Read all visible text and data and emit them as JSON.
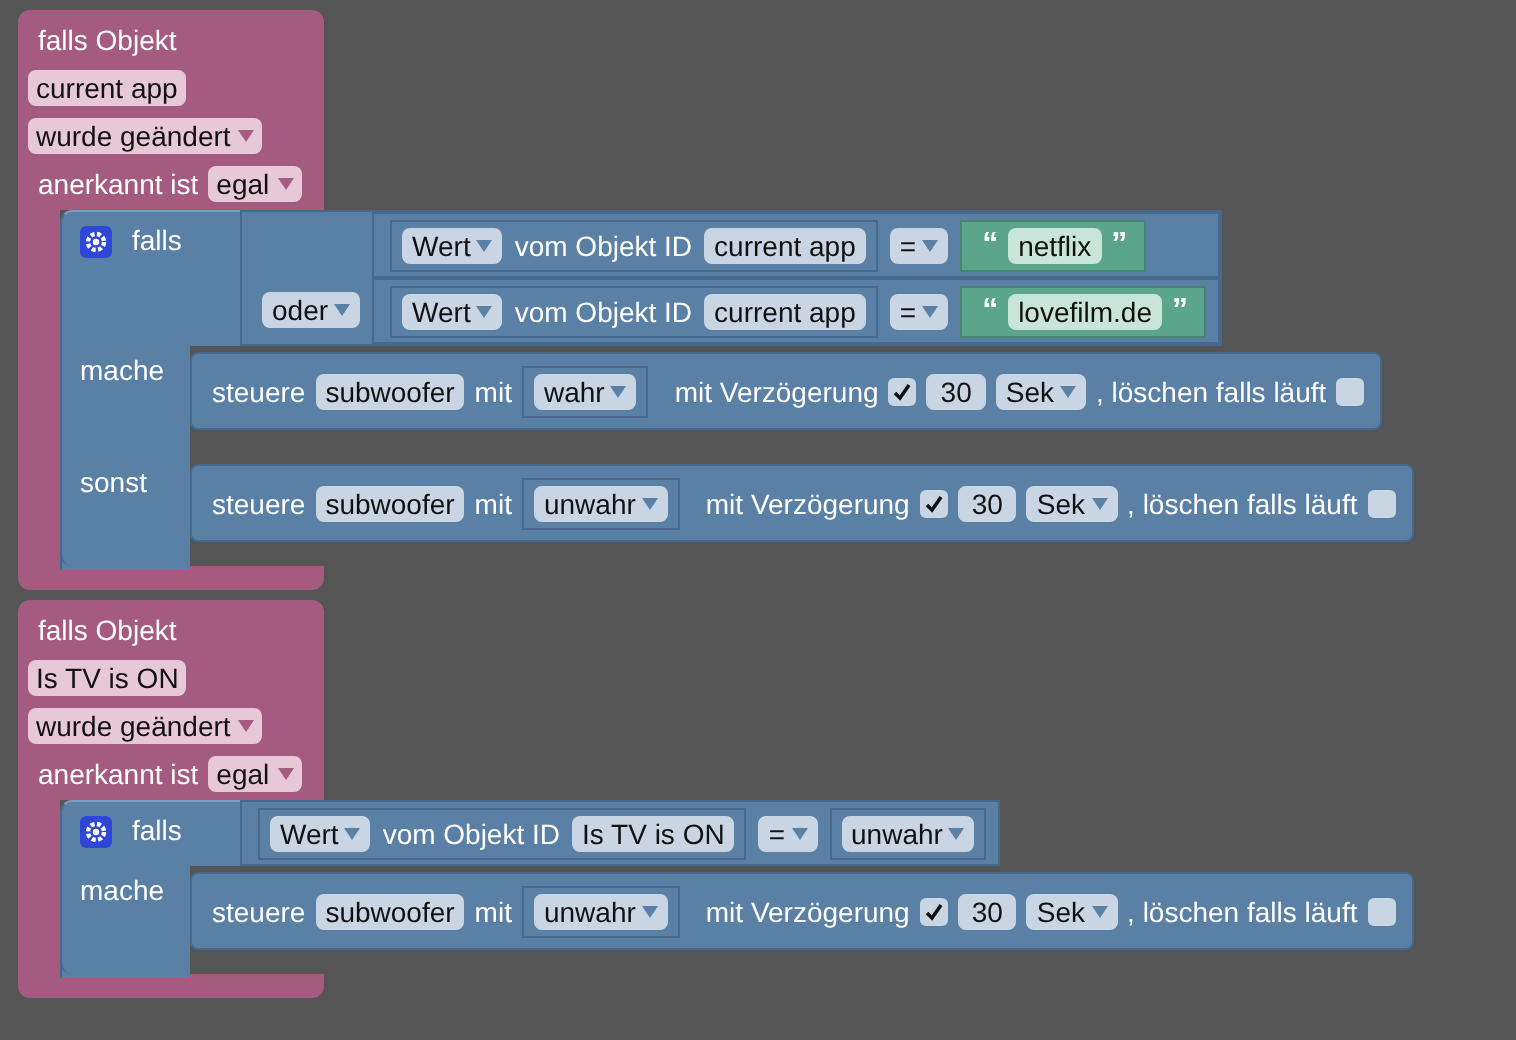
{
  "events": [
    {
      "header": "falls Objekt",
      "object": "current app",
      "trigger": "wurde geändert",
      "ack_label": "anerkannt ist",
      "ack": "egal",
      "if_block": {
        "label": "falls",
        "logic_op": "oder",
        "conditions": [
          {
            "value_field": "Wert",
            "id_label": "vom Objekt ID",
            "object": "current app",
            "operator": "=",
            "operand": {
              "kind": "string",
              "open_quote": "“",
              "text": "netflix",
              "close_quote": "”"
            }
          },
          {
            "value_field": "Wert",
            "id_label": "vom Objekt ID",
            "object": "current app",
            "operator": "=",
            "operand": {
              "kind": "string",
              "open_quote": "“",
              "text": "lovefilm.de",
              "close_quote": "”"
            }
          }
        ],
        "branches": [
          {
            "label": "mache",
            "action": {
              "verb": "steuere",
              "device": "subwoofer",
              "with": "mit",
              "value": "wahr",
              "delay_label": "mit Verzögerung",
              "delay_checked": true,
              "delay": "30",
              "unit": "Sek",
              "clear_label": ", löschen falls läuft",
              "clear_checked": false
            }
          },
          {
            "label": "sonst",
            "action": {
              "verb": "steuere",
              "device": "subwoofer",
              "with": "mit",
              "value": "unwahr",
              "delay_label": "mit Verzögerung",
              "delay_checked": true,
              "delay": "30",
              "unit": "Sek",
              "clear_label": ", löschen falls läuft",
              "clear_checked": false
            }
          }
        ]
      }
    },
    {
      "header": "falls Objekt",
      "object": "Is TV is ON",
      "trigger": "wurde geändert",
      "ack_label": "anerkannt ist",
      "ack": "egal",
      "if_block": {
        "label": "falls",
        "conditions": [
          {
            "value_field": "Wert",
            "id_label": "vom Objekt ID",
            "object": "Is TV is ON",
            "operator": "=",
            "operand": {
              "kind": "dropdown",
              "text": "unwahr"
            }
          }
        ],
        "branches": [
          {
            "label": "mache",
            "action": {
              "verb": "steuere",
              "device": "subwoofer",
              "with": "mit",
              "value": "unwahr",
              "delay_label": "mit Verzögerung",
              "delay_checked": true,
              "delay": "30",
              "unit": "Sek",
              "clear_label": ", löschen falls läuft",
              "clear_checked": false
            }
          }
        ]
      }
    }
  ]
}
